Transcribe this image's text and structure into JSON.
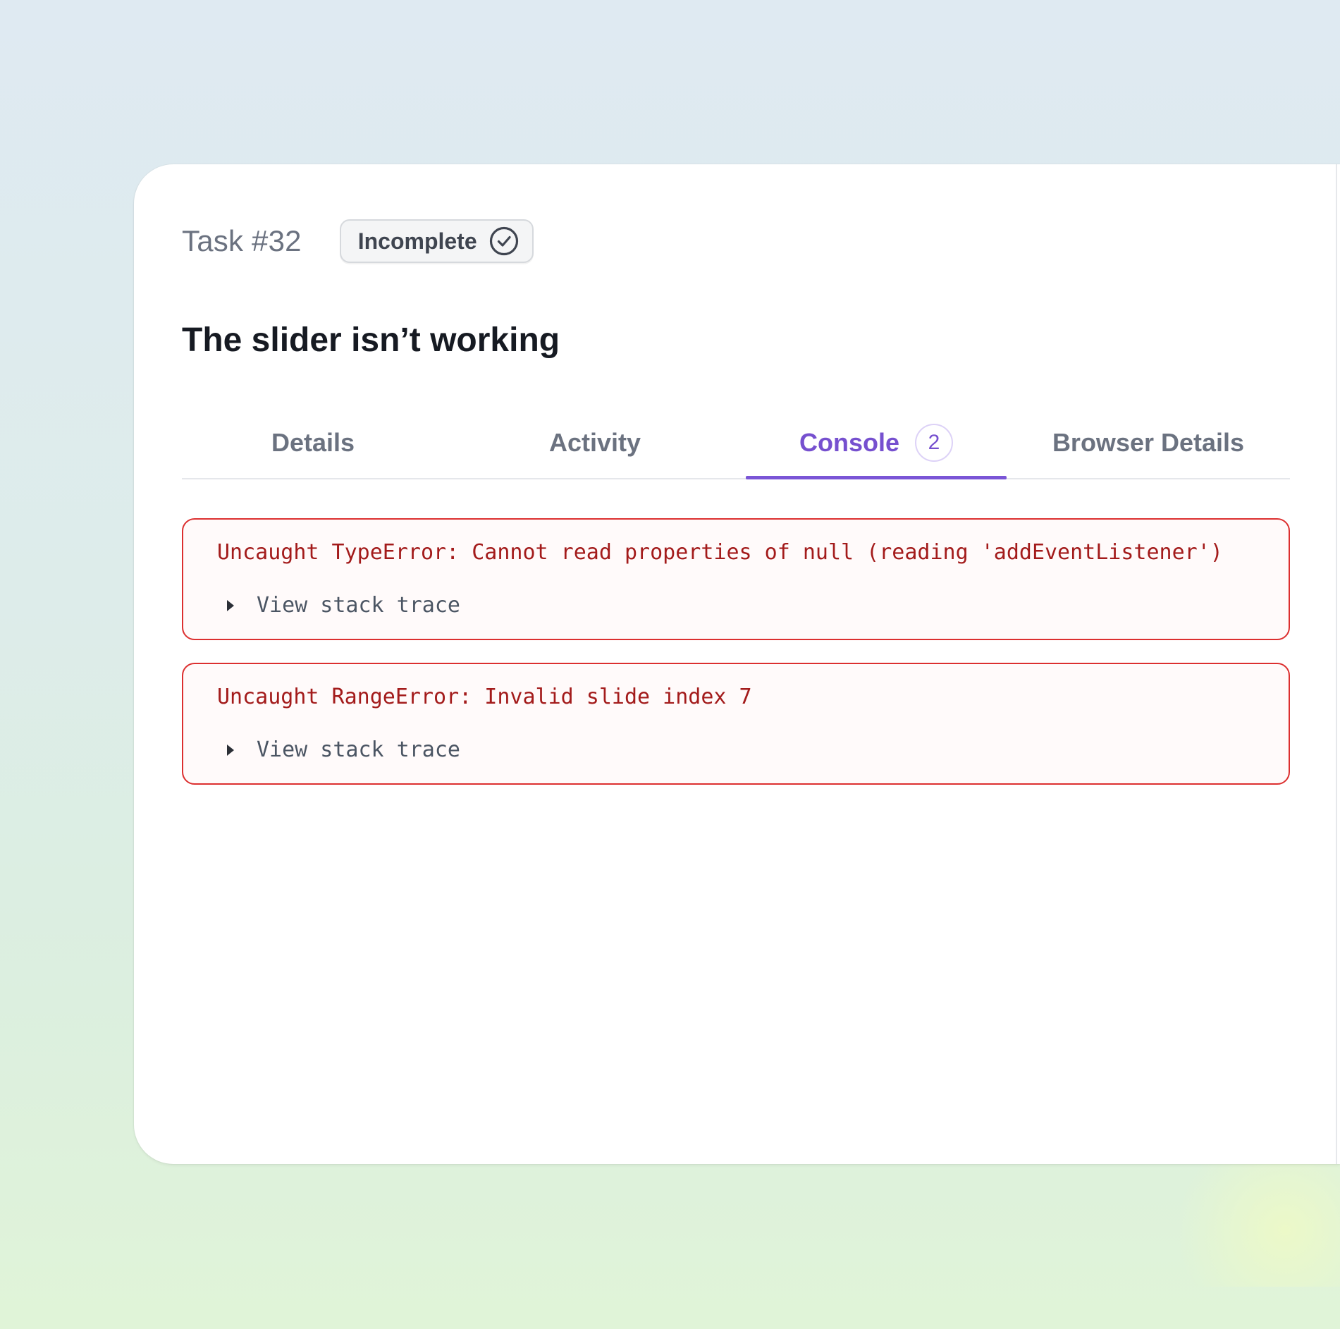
{
  "task": {
    "number": "Task #32",
    "status": "Incomplete",
    "title": "The slider isn’t working"
  },
  "tabs": [
    {
      "label": "Details",
      "active": false
    },
    {
      "label": "Activity",
      "active": false
    },
    {
      "label": "Console",
      "active": true,
      "count": "2"
    },
    {
      "label": "Browser Details",
      "active": false
    }
  ],
  "console": {
    "errors": [
      {
        "message": "Uncaught TypeError: Cannot read properties of null (reading 'addEventListener')",
        "toggle_label": "View stack trace"
      },
      {
        "message": "Uncaught RangeError: Invalid slide index 7",
        "toggle_label": "View stack trace"
      }
    ]
  },
  "colors": {
    "accent": "#7650cf",
    "error_border": "#dc2f2f",
    "error_text": "#a31b1b"
  },
  "icons": {
    "status": "check-circle-icon",
    "stack_toggle": "caret-right-icon"
  }
}
